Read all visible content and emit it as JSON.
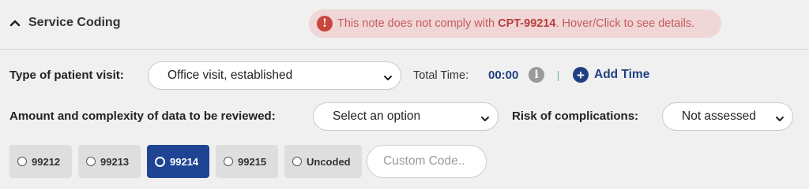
{
  "header": {
    "title": "Service Coding",
    "alert": {
      "prefix": "This note does not comply with ",
      "code": "CPT-99214",
      "suffix": ". Hover/Click to see details."
    }
  },
  "visit": {
    "label": "Type of patient visit:",
    "selected": "Office visit, established",
    "total_time_label": "Total Time:",
    "total_time_value": "00:00",
    "add_time_label": "Add Time"
  },
  "data_review": {
    "label": "Amount and complexity of data to be reviewed:",
    "selected": "Select an option"
  },
  "risk": {
    "label": "Risk of complications:",
    "selected": "Not assessed"
  },
  "codes": [
    {
      "label": "99212",
      "selected": false
    },
    {
      "label": "99213",
      "selected": false
    },
    {
      "label": "99214",
      "selected": true
    },
    {
      "label": "99215",
      "selected": false
    },
    {
      "label": "Uncoded",
      "selected": false
    }
  ],
  "custom_code": {
    "value": "",
    "placeholder": "Custom Code.."
  },
  "colors": {
    "accent": "#1f4493",
    "alert_bg": "#f0d6d6",
    "alert_text": "#c65b5b"
  },
  "icons": {
    "collapse": "chevron-up-icon",
    "alert": "exclamation-circle-icon",
    "info": "info-circle-icon",
    "add": "plus-circle-icon",
    "dropdown": "chevron-down-icon"
  }
}
